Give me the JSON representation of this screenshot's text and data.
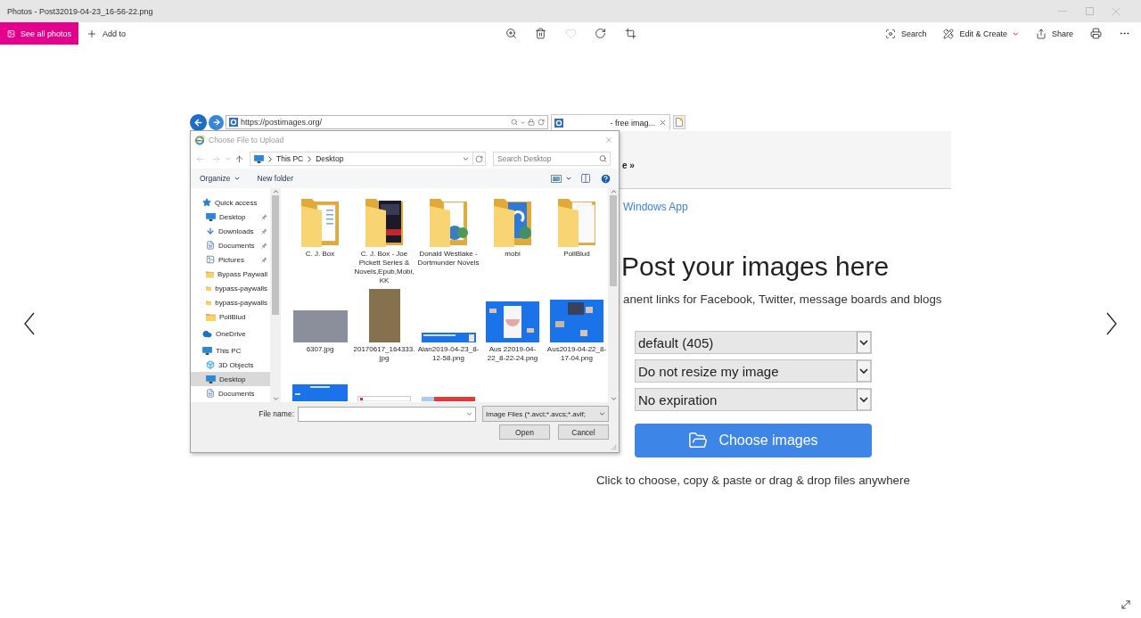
{
  "window": {
    "title": "Photos - Post32019-04-23_16-56-22.png"
  },
  "toolbar": {
    "left": [
      {
        "kind": "gallery",
        "label": "See all photos"
      },
      {
        "kind": "add",
        "label": "Add to"
      }
    ],
    "center": [
      {
        "kind": "zoom",
        "disabled": false
      },
      {
        "kind": "delete",
        "disabled": false
      },
      {
        "kind": "favorite",
        "disabled": true
      },
      {
        "kind": "rotate",
        "disabled": false
      },
      {
        "kind": "crop",
        "disabled": false
      }
    ],
    "right": [
      {
        "kind": "search",
        "label": "Search"
      },
      {
        "kind": "edit",
        "label": "Edit & Create"
      },
      {
        "kind": "share",
        "label": "Share"
      },
      {
        "kind": "print"
      },
      {
        "kind": "more"
      }
    ]
  },
  "screenshot": {
    "browser": {
      "url": "https://postimages.org/",
      "tab": "- free imag..."
    },
    "page": {
      "nav_text": "e »",
      "link": "Windows App",
      "heading": "Post your images here",
      "subtitle": "anent links for Facebook, Twitter, message boards and blogs",
      "selects": [
        "default (405)",
        "Do not resize my image",
        "No expiration"
      ],
      "button": "Choose images",
      "hint": "Click to choose, copy & paste or drag & drop files anywhere"
    },
    "dialog": {
      "title": "Choose File to Upload",
      "nav_buttons": [
        {
          "kind": "back",
          "disabled": true
        },
        {
          "kind": "forward",
          "disabled": true
        },
        {
          "kind": "recent",
          "disabled": true
        },
        {
          "kind": "up",
          "disabled": false
        }
      ],
      "path": [
        "This PC",
        "Desktop"
      ],
      "search": {
        "placeholder": "Search Desktop"
      },
      "commands": [
        {
          "label": "Organize",
          "menu": true
        },
        {
          "label": "New folder",
          "menu": false
        }
      ],
      "nav_pane": [
        {
          "kind": "quick_access",
          "label": "Quick access",
          "selected": false,
          "children": [
            {
              "kind": "desktop",
              "label": "Desktop",
              "pinned": true,
              "selected": false
            },
            {
              "kind": "downloads",
              "label": "Downloads",
              "pinned": true,
              "selected": false
            },
            {
              "kind": "documents",
              "label": "Documents",
              "pinned": true,
              "selected": false
            },
            {
              "kind": "pictures",
              "label": "Pictures",
              "pinned": true,
              "selected": false
            },
            {
              "kind": "folder",
              "label": "Bypass Paywall",
              "pinned": false,
              "selected": false
            },
            {
              "kind": "folder",
              "label": "bypass-paywalls",
              "pinned": false,
              "selected": false
            },
            {
              "kind": "folder",
              "label": "bypass-paywalls",
              "pinned": false,
              "selected": false
            },
            {
              "kind": "folder",
              "label": "PollBlud",
              "pinned": false,
              "selected": false
            }
          ]
        },
        {
          "kind": "onedrive",
          "label": "OneDrive",
          "selected": false
        },
        {
          "kind": "pc",
          "label": "This PC",
          "selected": false,
          "children": [
            {
              "kind": "cube",
              "label": "3D Objects",
              "selected": false
            },
            {
              "kind": "desktop",
              "label": "Desktop",
              "selected": true
            },
            {
              "kind": "documents",
              "label": "Documents",
              "selected": false
            }
          ]
        }
      ],
      "files": [
        {
          "kind": "folder",
          "name": "C. J. Box"
        },
        {
          "kind": "folder",
          "name": "C. J. Box - Joe Pickett Series & Novels,Epub,Mobi, KK"
        },
        {
          "kind": "folder",
          "name": "Donald Westlake - Dortmunder Novels"
        },
        {
          "kind": "folder",
          "name": "mobi"
        },
        {
          "kind": "folder",
          "name": "PollBlud"
        },
        {
          "kind": "photo",
          "name": "6307.jpg"
        },
        {
          "kind": "photo",
          "name": "20170617_164333.jpg"
        },
        {
          "kind": "screenshot",
          "name": "Alan2019-04-23_8-12-58.png"
        },
        {
          "kind": "screenshot",
          "name": "Aus 22019-04-22_8-22-24.png"
        },
        {
          "kind": "screenshot",
          "name": "Aus2019-04-22_8-17-04.png"
        }
      ],
      "files_next_row": [
        {
          "kind": "screenshot"
        },
        {
          "kind": "document"
        },
        {
          "kind": "screenshot"
        }
      ],
      "file_name": {
        "label": "File name:"
      },
      "file_type": "Image Files (*.avci;*.avcs;*.avif;",
      "buttons": [
        "Open",
        "Cancel"
      ]
    }
  }
}
